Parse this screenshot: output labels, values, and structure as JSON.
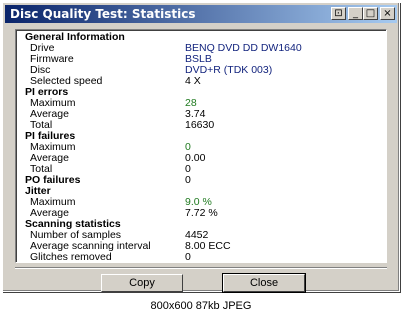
{
  "window": {
    "title": "Disc Quality Test: Statistics",
    "buttons": {
      "pin": "⊡",
      "minimize": "_",
      "maximize": "□",
      "close": "×"
    }
  },
  "sections": [
    {
      "heading": "General Information",
      "rows": [
        {
          "label": "Drive",
          "value": "BENQ     DVD DD DW1640",
          "style": "blue"
        },
        {
          "label": "Firmware",
          "value": "BSLB",
          "style": "blue"
        },
        {
          "label": "Disc",
          "value": "DVD+R (TDK 003)",
          "style": "blue"
        },
        {
          "label": "Selected speed",
          "value": "4 X",
          "style": "plain"
        }
      ]
    },
    {
      "heading": "PI errors",
      "rows": [
        {
          "label": "Maximum",
          "value": "28",
          "style": "green"
        },
        {
          "label": "Average",
          "value": "3.74",
          "style": "plain"
        },
        {
          "label": "Total",
          "value": "16630",
          "style": "plain"
        }
      ]
    },
    {
      "heading": "PI failures",
      "rows": [
        {
          "label": "Maximum",
          "value": "0",
          "style": "green"
        },
        {
          "label": "Average",
          "value": "0.00",
          "style": "plain"
        },
        {
          "label": "Total",
          "value": "0",
          "style": "plain"
        }
      ]
    },
    {
      "heading": "PO failures",
      "rows": [],
      "value": "0"
    },
    {
      "heading": "Jitter",
      "rows": [
        {
          "label": "Maximum",
          "value": "9.0 %",
          "style": "green"
        },
        {
          "label": "Average",
          "value": "7.72 %",
          "style": "plain"
        }
      ]
    },
    {
      "heading": "Scanning statistics",
      "rows": [
        {
          "label": "Number of samples",
          "value": "4452",
          "style": "plain"
        },
        {
          "label": "Average scanning interval",
          "value": "8.00 ECC",
          "style": "plain"
        },
        {
          "label": "Glitches removed",
          "value": "0",
          "style": "plain"
        }
      ]
    }
  ],
  "actions": {
    "copy": "Copy",
    "close": "Close"
  },
  "caption": "800x600 87kb JPEG",
  "colors": {
    "titlebar_start": "#0a246a",
    "titlebar_end": "#a6caf0",
    "green_value": "#1f7a1f",
    "blue_value": "#13247e"
  }
}
